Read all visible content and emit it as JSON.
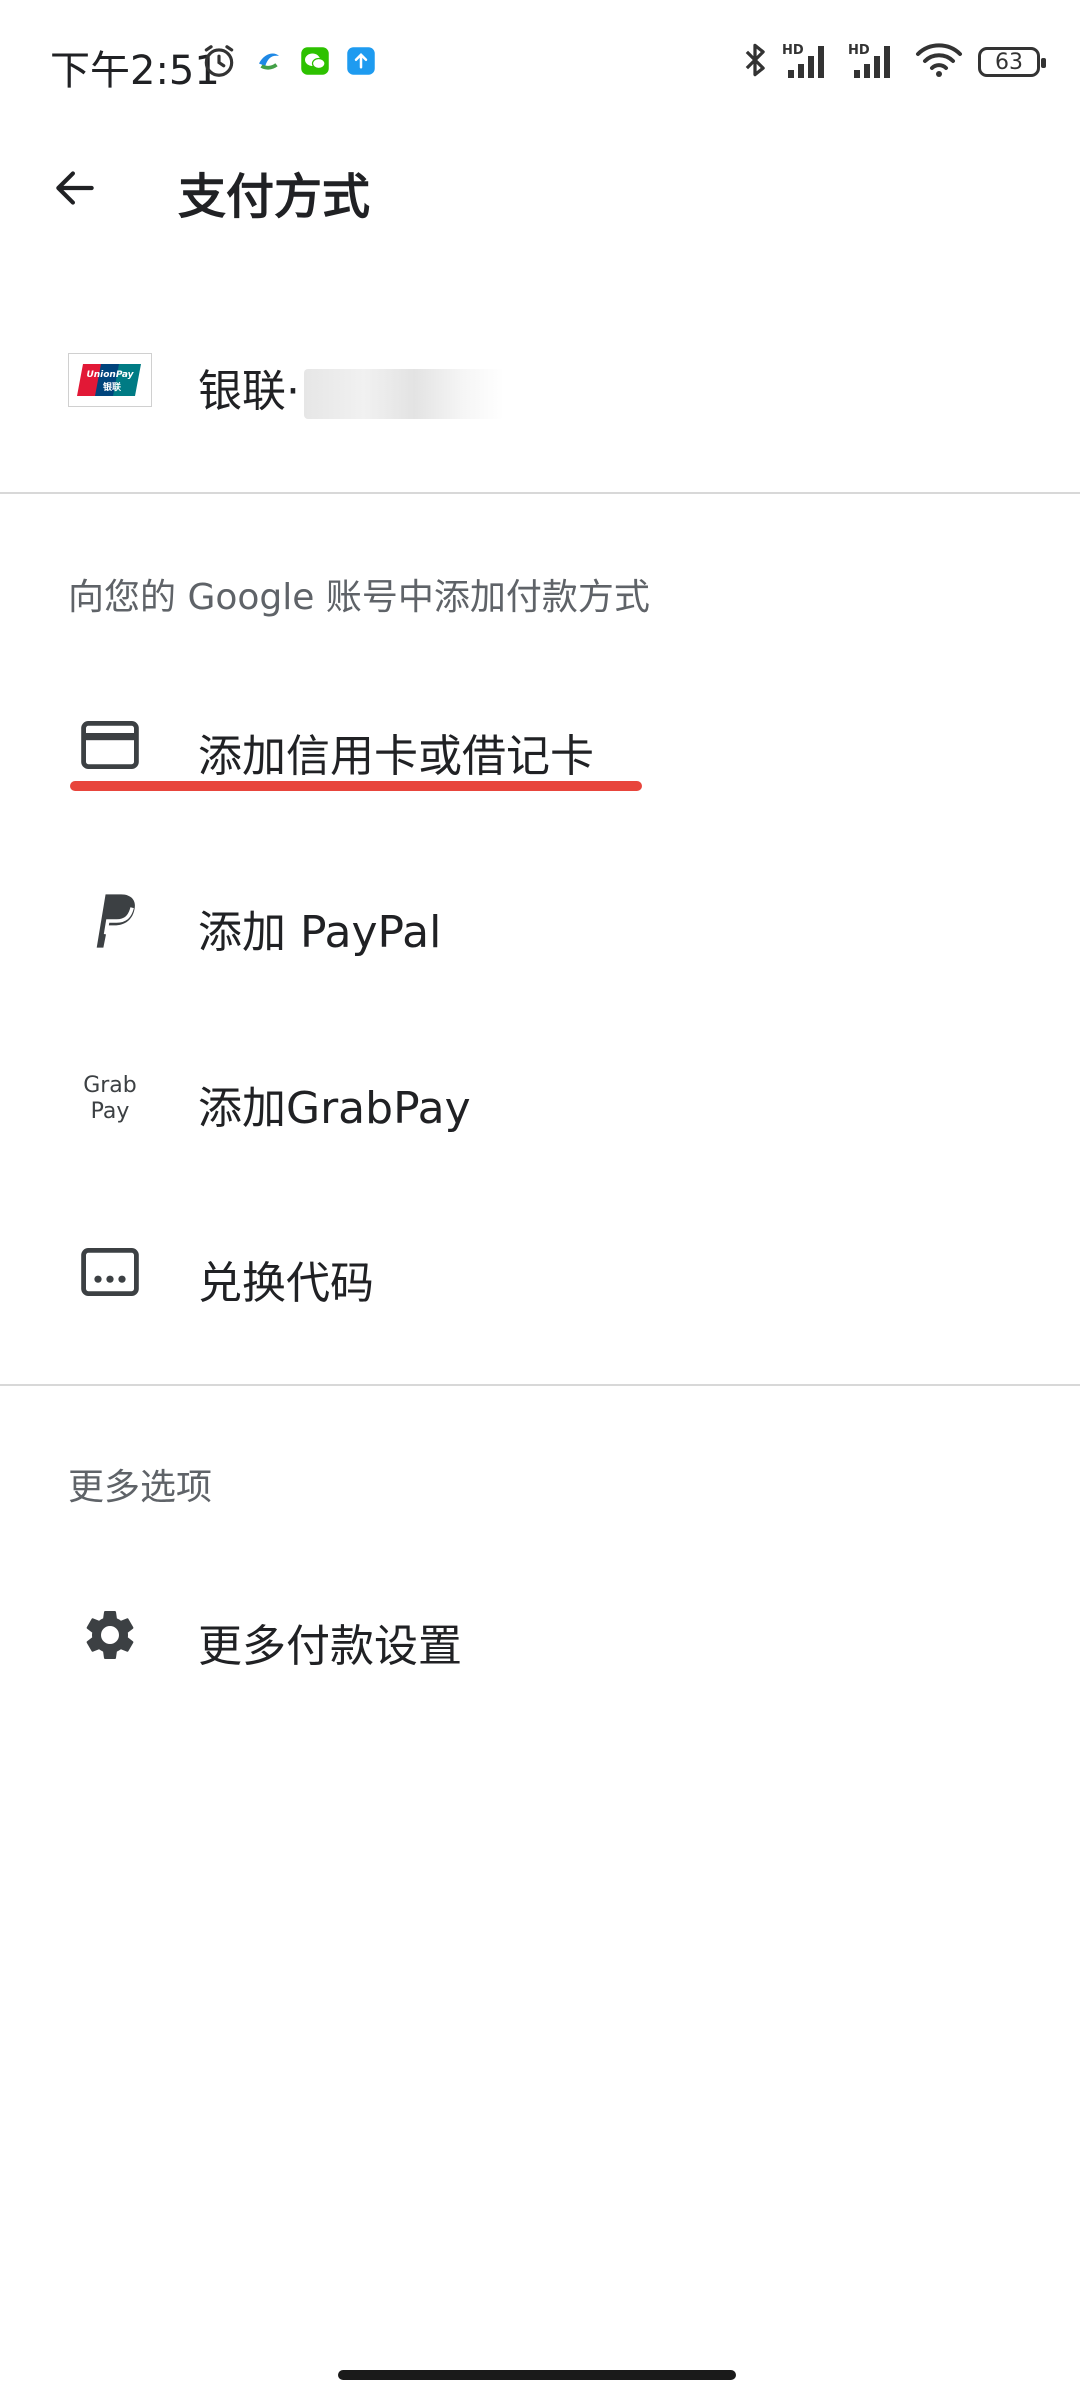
{
  "status_bar": {
    "time": "下午2:51",
    "battery": "63",
    "icons": [
      "alarm-icon",
      "app-notification-icon",
      "wechat-icon",
      "upload-icon",
      "bluetooth-icon",
      "signal-hd-icon",
      "signal-hd-icon",
      "wifi-icon",
      "battery-icon"
    ]
  },
  "header": {
    "title": "支付方式"
  },
  "saved_card": {
    "label": "银联·",
    "icon": "unionpay-logo"
  },
  "add_section": {
    "header": "向您的 Google 账号中添加付款方式",
    "items": [
      {
        "label": "添加信用卡或借记卡",
        "icon": "credit-card-icon"
      },
      {
        "label": "添加 PayPal",
        "icon": "paypal-icon"
      },
      {
        "label": "添加GrabPay",
        "icon": "grabpay-icon",
        "icon_text_line1": "Grab",
        "icon_text_line2": "Pay"
      },
      {
        "label": "兑换代码",
        "icon": "redeem-code-icon"
      }
    ]
  },
  "more_section": {
    "header": "更多选项",
    "items": [
      {
        "label": "更多付款设置",
        "icon": "gear-icon"
      }
    ]
  },
  "colors": {
    "highlight": "#e8453c",
    "text": "#202124",
    "secondary": "#5f6368",
    "divider": "#d8d8d8"
  }
}
